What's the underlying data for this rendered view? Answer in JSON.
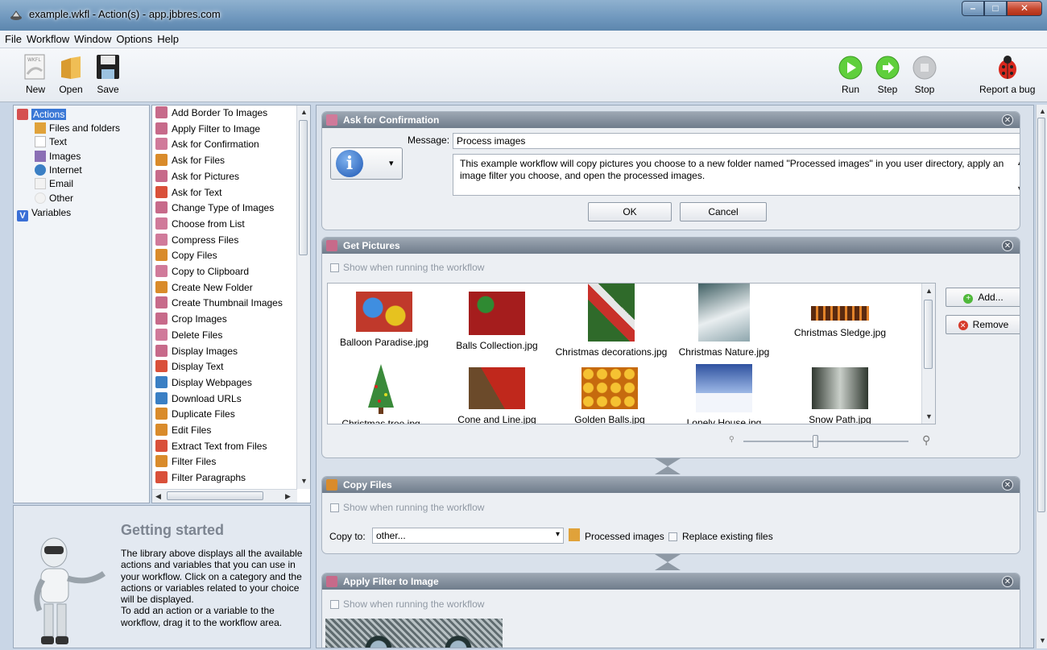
{
  "window": {
    "title": "example.wkfl - Action(s) - app.jbbres.com",
    "min": "–",
    "max": "□",
    "close": "✕"
  },
  "menu": [
    "File",
    "Workflow",
    "Window",
    "Options",
    "Help"
  ],
  "toolbar": {
    "new": "New",
    "open": "Open",
    "save": "Save",
    "run": "Run",
    "step": "Step",
    "stop": "Stop",
    "report": "Report a bug",
    "wkfl_badge": "WKFL"
  },
  "categories": [
    {
      "label": "Actions",
      "icon": "actions-icon",
      "color": "#d55050"
    },
    {
      "label": "Files and folders",
      "icon": "folder-icon",
      "color": "#e0a23a"
    },
    {
      "label": "Text",
      "icon": "text-doc-icon",
      "color": "#d8d8d8"
    },
    {
      "label": "Images",
      "icon": "images-icon",
      "color": "#8a6fb5"
    },
    {
      "label": "Internet",
      "icon": "globe-icon",
      "color": "#3a7fc4"
    },
    {
      "label": "Email",
      "icon": "email-icon",
      "color": "#e6e6e6"
    },
    {
      "label": "Other",
      "icon": "other-icon",
      "color": "#e8e8e8"
    },
    {
      "label": "Variables",
      "icon": "variables-icon",
      "color": "#3a6fd6",
      "glyph": "V"
    }
  ],
  "actions": [
    {
      "label": "Add Border To Images",
      "color": "#c76a8a"
    },
    {
      "label": "Apply Filter to Image",
      "color": "#c76a8a"
    },
    {
      "label": "Ask for Confirmation",
      "color": "#d07a9a"
    },
    {
      "label": "Ask for Files",
      "color": "#d98b2b"
    },
    {
      "label": "Ask for Pictures",
      "color": "#c76a8a"
    },
    {
      "label": "Ask for Text",
      "color": "#d9503a"
    },
    {
      "label": "Change Type of Images",
      "color": "#c76a8a"
    },
    {
      "label": "Choose from List",
      "color": "#d07a9a"
    },
    {
      "label": "Compress Files",
      "color": "#d07a9a"
    },
    {
      "label": "Copy Files",
      "color": "#d98b2b"
    },
    {
      "label": "Copy to Clipboard",
      "color": "#d07a9a"
    },
    {
      "label": "Create New Folder",
      "color": "#d98b2b"
    },
    {
      "label": "Create Thumbnail Images",
      "color": "#c76a8a"
    },
    {
      "label": "Crop Images",
      "color": "#c76a8a"
    },
    {
      "label": "Delete Files",
      "color": "#d07a9a"
    },
    {
      "label": "Display Images",
      "color": "#c76a8a"
    },
    {
      "label": "Display Text",
      "color": "#d9503a"
    },
    {
      "label": "Display Webpages",
      "color": "#3a7fc4"
    },
    {
      "label": "Download URLs",
      "color": "#3a7fc4"
    },
    {
      "label": "Duplicate Files",
      "color": "#d98b2b"
    },
    {
      "label": "Edit Files",
      "color": "#d98b2b"
    },
    {
      "label": "Extract Text from Files",
      "color": "#d9503a"
    },
    {
      "label": "Filter Files",
      "color": "#d98b2b"
    },
    {
      "label": "Filter Paragraphs",
      "color": "#d9503a"
    }
  ],
  "getting_started": {
    "title": "Getting started",
    "text": "The library above displays all the available actions and variables that you can use in your workflow. Click on a category and the actions or variables related to your choice will be displayed.\nTo add an action or a variable to the workflow, drag it to the workflow area."
  },
  "ask_confirmation": {
    "title": "Ask for Confirmation",
    "message_label": "Message:",
    "message_value": "Process images",
    "body": "This example workflow will copy pictures you choose to a new folder named \"Processed images\" in you user directory, apply an image filter you choose, and open the processed images.",
    "ok": "OK",
    "cancel": "Cancel",
    "icon_glyph": "i",
    "dropdown_glyph": "▾"
  },
  "get_pictures": {
    "title": "Get Pictures",
    "show_label": "Show when running the workflow",
    "add": "Add...",
    "remove": "Remove",
    "images": [
      {
        "name": "Balloon Paradise.jpg",
        "color": "#c0392b"
      },
      {
        "name": "Balls Collection.jpg",
        "color": "#a51d1d"
      },
      {
        "name": "Christmas decorations.jpg",
        "color": "#2f6a2a"
      },
      {
        "name": "Christmas Nature.jpg",
        "color": "#8ea6ad"
      },
      {
        "name": "Christmas Sledge.jpg",
        "color": "#5a2a10"
      },
      {
        "name": "Christmas tree.jpg",
        "color": "#3a8a3a"
      },
      {
        "name": "Cone and Line.jpg",
        "color": "#c0281c"
      },
      {
        "name": "Golden Balls.jpg",
        "color": "#c66a0e"
      },
      {
        "name": "Lonely House.jpg",
        "color": "#5a7fbf"
      },
      {
        "name": "Snow Path.jpg",
        "color": "#8e948e"
      }
    ]
  },
  "copy_files": {
    "title": "Copy Files",
    "show_label": "Show when running the workflow",
    "copy_to_label": "Copy to:",
    "copy_to_value": "other...",
    "folder_name": "Processed images",
    "replace_label": "Replace existing files"
  },
  "apply_filter": {
    "title": "Apply Filter to Image",
    "show_label": "Show when running the workflow"
  }
}
